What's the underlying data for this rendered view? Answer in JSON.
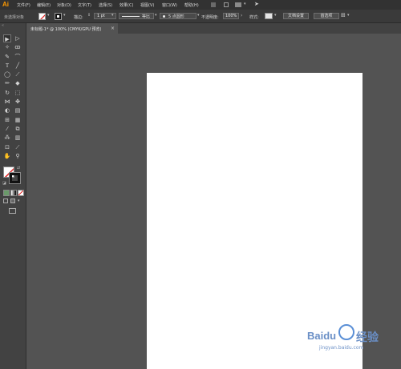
{
  "app": {
    "logo": "Ai"
  },
  "menu": [
    "文件(F)",
    "编辑(E)",
    "对象(O)",
    "文字(T)",
    "选择(S)",
    "效果(C)",
    "视图(V)",
    "窗口(W)",
    "帮助(H)"
  ],
  "control": {
    "selection_status": "未选择对象",
    "stroke_label": "描边:",
    "stroke_value": "1 pt",
    "profile_label": "等比",
    "brush_label": "5 点圆形",
    "opacity_label": "不透明度:",
    "opacity_value": "100%",
    "style_label": "样式:",
    "doc_setup_button": "文档设置",
    "prefs_button": "首选项"
  },
  "tab": {
    "title": "未标题-1* @ 100% (CMYK/GPU 预览)",
    "close": "×"
  },
  "watermark": {
    "brand": "Baidu",
    "suffix": "经验",
    "url": "jingyan.baidu.com"
  },
  "colors": {
    "background": "#535353",
    "menubar": "#323232",
    "panel": "#424242",
    "artboard": "#ffffff",
    "accent": "#ff9a00",
    "watermark": "#5a8fd6"
  }
}
